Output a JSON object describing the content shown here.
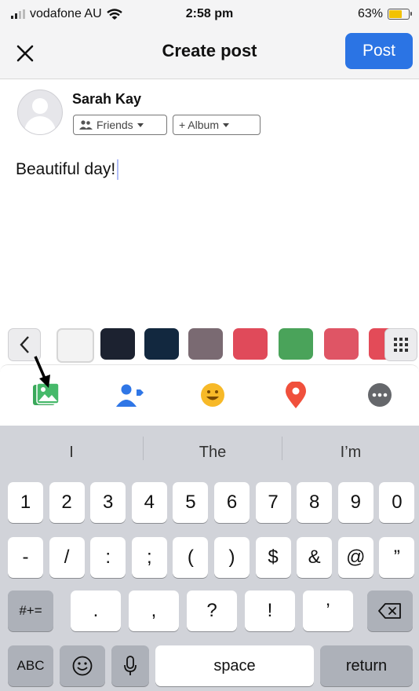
{
  "status_bar": {
    "carrier": "vodafone AU",
    "time": "2:58 pm",
    "battery_percent": "63%",
    "battery_level": 0.63
  },
  "header": {
    "title": "Create post",
    "post_label": "Post"
  },
  "author": {
    "name": "Sarah Kay",
    "audience_label": "Friends",
    "album_label": "+ Album"
  },
  "composer": {
    "text": "Beautiful day!"
  },
  "backgrounds": {
    "icons": [
      "chevron-left-icon",
      "grid-icon"
    ],
    "swatches": [
      "#f3f3f3",
      "#1c2230",
      "#12283f",
      "#7a6a72",
      "#e04a5a",
      "#4aa35a",
      "#df5565",
      "#e34b58"
    ]
  },
  "tools": [
    "photo-icon",
    "tag-people-icon",
    "feeling-icon",
    "location-icon",
    "more-icon"
  ],
  "keyboard": {
    "suggestions": [
      "I",
      "The",
      "I’m"
    ],
    "row1": [
      "1",
      "2",
      "3",
      "4",
      "5",
      "6",
      "7",
      "8",
      "9",
      "0"
    ],
    "row2": [
      "-",
      "/",
      ":",
      ";",
      "(",
      ")",
      "$",
      "&",
      "@",
      "”"
    ],
    "row3": {
      "switch": "#+=",
      "keys": [
        ".",
        ",",
        "?",
        "!",
        "’"
      ]
    },
    "row4": {
      "abc": "ABC",
      "space": "space",
      "return": "return"
    }
  }
}
